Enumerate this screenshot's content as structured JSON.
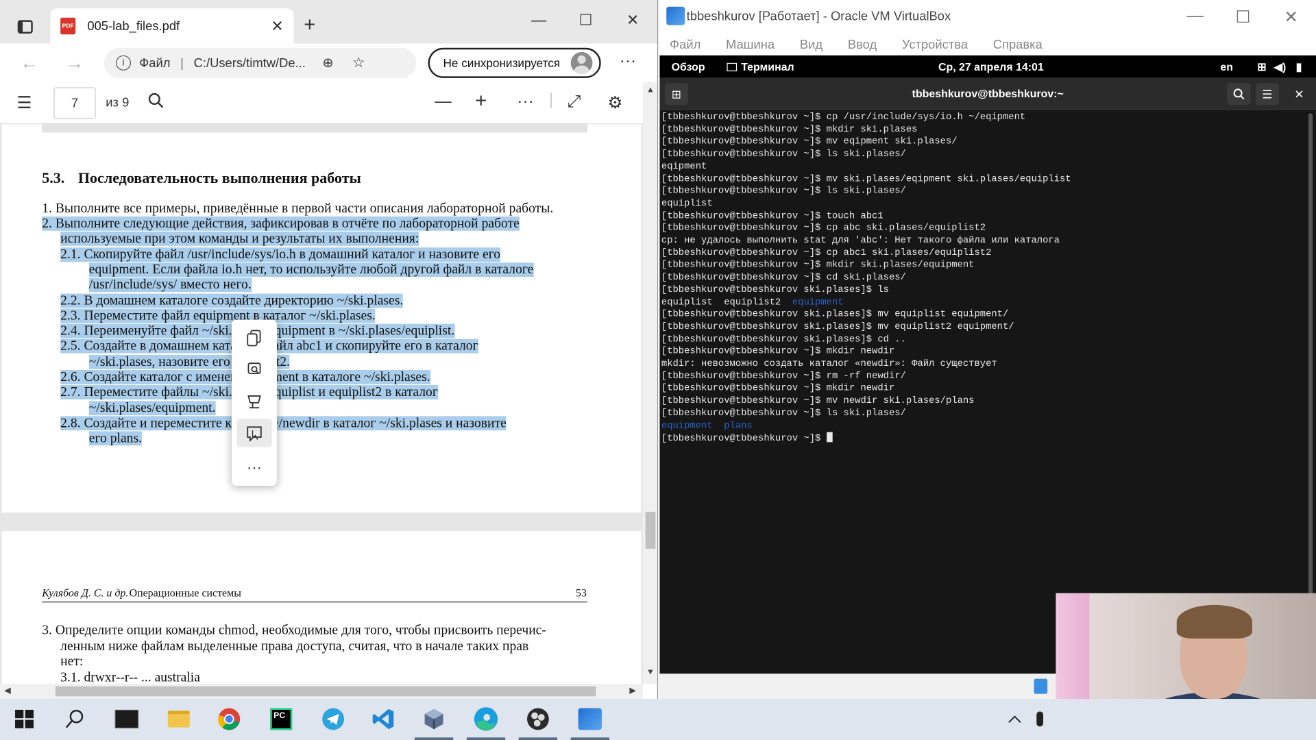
{
  "edge": {
    "tab_title": "005-lab_files.pdf",
    "tab_close": "✕",
    "new_tab": "+",
    "url_scheme": "Файл",
    "url_path": "C:/Users/timtw/De...",
    "sync_label": "Не синхронизируется",
    "page_current": "7",
    "page_total": "из 9"
  },
  "pdf": {
    "section_num": "5.3.",
    "section_title": "Последовательность выполнения работы",
    "lines": [
      "1.  Выполните все примеры, приведённые в первой части описания лабораторной работы.",
      "2.  Выполните следующие действия, зафиксировав в отчёте по лабораторной работе",
      "используемые при этом команды и результаты их выполнения:",
      "2.1.  Скопируйте файл /usr/include/sys/io.h в домашний каталог и назовите его",
      "equipment. Если файла io.h нет, то используйте любой другой файл в каталоге",
      "/usr/include/sys/ вместо него.",
      "2.2.  В домашнем каталоге создайте директорию ~/ski.plases.",
      "2.3.  Переместите файл equipment в каталог ~/ski.plases.",
      "2.4.  Переименуйте файл ~/ski.plases/equipment в ~/ski.plases/equiplist.",
      "2.5.  Создайте в домашнем каталоге файл abc1 и скопируйте его в каталог",
      "~/ski.plases, назовите его equiplist2.",
      "2.6.  Создайте каталог с именем equipment в каталоге ~/ski.plases.",
      "2.7.  Переместите файлы ~/ski.plases/equiplist и equiplist2 в каталог",
      "~/ski.plases/equipment.",
      "2.8.  Создайте и переместите каталог ~/newdir в каталог ~/ski.plases и назовите",
      "его plans."
    ],
    "footer_author": "Кулябов Д. С. и др.",
    "footer_title": "Операционные системы",
    "footer_page": "53",
    "page2_lines": [
      "3.  Определите опции команды chmod, необходимые для того, чтобы присвоить перечис-",
      "ленным ниже файлам выделенные права доступа, считая, что в начале таких прав",
      "нет:",
      "3.1.  drwxr--r--    ...    australia"
    ]
  },
  "vbox": {
    "title": "tbbeshkurov [Работает] - Oracle VM VirtualBox",
    "menu": [
      "Файл",
      "Машина",
      "Вид",
      "Ввод",
      "Устройства",
      "Справка"
    ],
    "gnome": {
      "overview": "Обзор",
      "terminal": "Терминал",
      "datetime": "Ср, 27 апреля  14:01",
      "lang": "en"
    },
    "terminal_title": "tbbeshkurov@tbbeshkurov:~",
    "terminal_lines": [
      {
        "t": "[tbbeshkurov@tbbeshkurov ~]$ cp /usr/include/sys/io.h ~/eqipment"
      },
      {
        "t": "[tbbeshkurov@tbbeshkurov ~]$ mkdir ski.plases"
      },
      {
        "t": "[tbbeshkurov@tbbeshkurov ~]$ mv eqipment ski.plases/"
      },
      {
        "t": "[tbbeshkurov@tbbeshkurov ~]$ ls ski.plases/"
      },
      {
        "t": "eqipment"
      },
      {
        "t": "[tbbeshkurov@tbbeshkurov ~]$ mv ski.plases/eqipment ski.plases/equiplist"
      },
      {
        "t": "[tbbeshkurov@tbbeshkurov ~]$ ls ski.plases/"
      },
      {
        "t": "equiplist"
      },
      {
        "t": "[tbbeshkurov@tbbeshkurov ~]$ touch abc1"
      },
      {
        "t": "[tbbeshkurov@tbbeshkurov ~]$ cp abc ski.plases/equiplist2"
      },
      {
        "t": "cp: не удалось выполнить stat для 'abc': Нет такого файла или каталога"
      },
      {
        "t": "[tbbeshkurov@tbbeshkurov ~]$ cp abc1 ski.plases/equiplist2"
      },
      {
        "t": "[tbbeshkurov@tbbeshkurov ~]$ mkdir ski.plases/equipment"
      },
      {
        "t": "[tbbeshkurov@tbbeshkurov ~]$ cd ski.plases/"
      },
      {
        "t": "[tbbeshkurov@tbbeshkurov ski.plases]$ ls"
      },
      {
        "t": "equiplist  equiplist2  ",
        "dir": "equipment"
      },
      {
        "t": "[tbbeshkurov@tbbeshkurov ski.plases]$ mv equiplist equipment/"
      },
      {
        "t": "[tbbeshkurov@tbbeshkurov ski.plases]$ mv equiplist2 equipment/"
      },
      {
        "t": "[tbbeshkurov@tbbeshkurov ski.plases]$ cd .."
      },
      {
        "t": "[tbbeshkurov@tbbeshkurov ~]$ mkdir newdir"
      },
      {
        "t": "mkdir: невозможно создать каталог «newdir»: Файл существует"
      },
      {
        "t": "[tbbeshkurov@tbbeshkurov ~]$ rm -rf newdir/"
      },
      {
        "t": "[tbbeshkurov@tbbeshkurov ~]$ mkdir newdir"
      },
      {
        "t": "[tbbeshkurov@tbbeshkurov ~]$ mv newdir ski.plases/plans"
      },
      {
        "t": "[tbbeshkurov@tbbeshkurov ~]$ ls ski.plases/"
      },
      {
        "t": "",
        "dir": "equipment  plans"
      },
      {
        "t": "[tbbeshkurov@tbbeshkurov ~]$ ",
        "cursor": true
      }
    ]
  },
  "taskbar": {
    "apps": [
      "windows-start",
      "search",
      "terminal",
      "file-explorer",
      "chrome",
      "pycharm",
      "telegram",
      "vscode",
      "virtualbox-cube",
      "edge",
      "obs",
      "virtualbox"
    ]
  }
}
